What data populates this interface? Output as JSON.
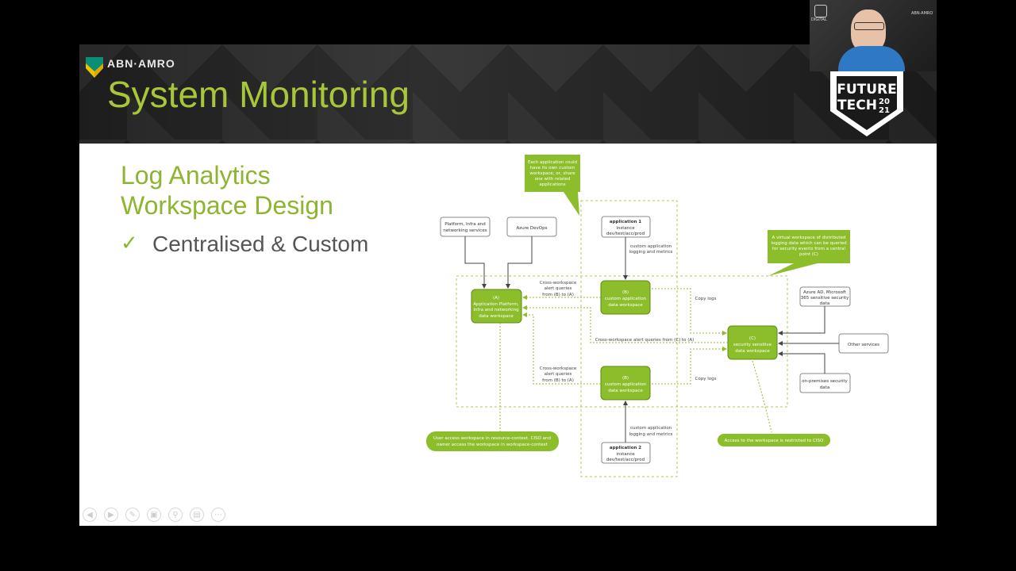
{
  "header": {
    "brand": "ABN·AMRO",
    "title": "System Monitoring",
    "event_badge_line1": "FUTURE",
    "event_badge_line2": "TECH",
    "event_year_top": "20",
    "event_year_bottom": "21"
  },
  "slide": {
    "subtitle_line1": "Log Analytics",
    "subtitle_line2": "Workspace Design",
    "bullet_check": "✓",
    "bullet_text": "Centralised & Custom"
  },
  "diagram": {
    "callout_top": [
      "Each application could",
      "have its own custom",
      "workspace, or, share",
      "one with related",
      "applications"
    ],
    "callout_right": [
      "A virtual workspace of distributed",
      "logging data which can be queried",
      "for security events from a central",
      "point (C)"
    ],
    "box_platform": [
      "Platform, Infra and",
      "networking services"
    ],
    "box_devops": "Azure DevOps",
    "box_app1": [
      "application 1",
      "instance",
      "dev/test/acc/prod"
    ],
    "box_app2": [
      "application 2",
      "instance",
      "dev/test/acc/prod"
    ],
    "box_azuread": [
      "Azure AD, Microsoft",
      "365 sensitive security",
      "data"
    ],
    "box_other": "Other services",
    "box_onprem": [
      "on-premises security",
      "data"
    ],
    "ws_a": [
      "(A)",
      "Application Platform,",
      "Infra and networking",
      "data workspace"
    ],
    "ws_b1": [
      "(B)",
      "custom application",
      "data workspace"
    ],
    "ws_b2": [
      "(B)",
      "custom application",
      "data workspace"
    ],
    "ws_c": [
      "(C)",
      "security sensitive",
      "data workspace"
    ],
    "label_custom_top": [
      "custom application",
      "logging and metrics"
    ],
    "label_custom_bottom": [
      "custom application",
      "logging and metrics"
    ],
    "label_cross_top": [
      "Cross-workspace",
      "alert queries",
      "from (B) to (A)"
    ],
    "label_cross_bottom": [
      "Cross-workspace",
      "alert queries",
      "from (B) to (A)"
    ],
    "label_cross_c": "Cross-workspace alert queries from (C) to (A)",
    "label_copy_top": "Copy logs",
    "label_copy_bottom": "Copy logs",
    "note_left": [
      "User access workspace in resource-context. CISO and",
      "owner access the workspace in workspace-context"
    ],
    "note_right": "Access to the workspace is restricted to CISO"
  },
  "webcam": {
    "label_left": "DIGITAL",
    "label_right": "ABN·AMRO"
  },
  "colors": {
    "accent": "#8db530",
    "box_fill": "#8cbd2a",
    "dashed": "#a8cc50",
    "dark_text": "#333333"
  }
}
